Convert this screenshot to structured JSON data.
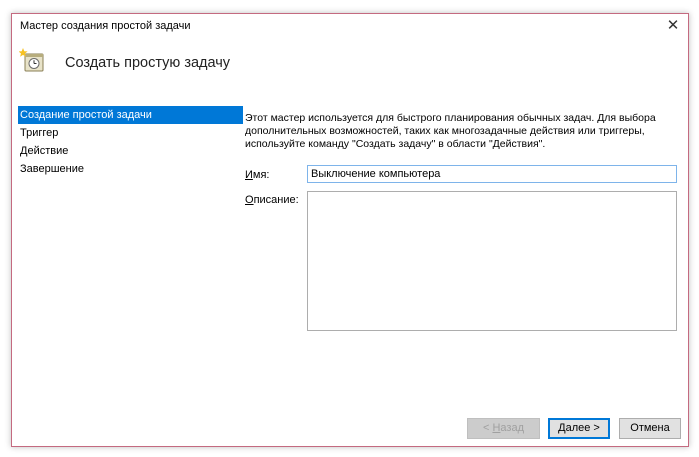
{
  "window": {
    "title": "Мастер создания простой задачи",
    "close_glyph": "✕"
  },
  "header": {
    "title": "Создать простую задачу",
    "icon": "task-scheduler-icon"
  },
  "sidebar": {
    "items": [
      {
        "label": "Создание простой задачи",
        "active": true
      },
      {
        "label": "Триггер",
        "active": false
      },
      {
        "label": "Действие",
        "active": false
      },
      {
        "label": "Завершение",
        "active": false
      }
    ]
  },
  "content": {
    "description": "Этот мастер используется для быстрого планирования обычных задач.  Для выбора дополнительных возможностей, таких как многозадачные действия или триггеры, используйте команду \"Создать задачу\" в области \"Действия\".",
    "name_label_mnemonic": "И",
    "name_label_rest": "мя:",
    "name_value": "Выключение компьютера",
    "desc_label_mnemonic": "О",
    "desc_label_rest": "писание:",
    "desc_value": ""
  },
  "buttons": {
    "back": {
      "prefix": "< ",
      "mnemonic": "Н",
      "rest": "азад",
      "enabled": false
    },
    "next": {
      "mnemonic": "Д",
      "rest": "алее >",
      "enabled": true
    },
    "cancel": {
      "label": "Отмена",
      "enabled": true
    }
  },
  "colors": {
    "selection": "#0078d7",
    "window_border": "#c46a80",
    "input_focus_border": "#7eb4ea"
  }
}
